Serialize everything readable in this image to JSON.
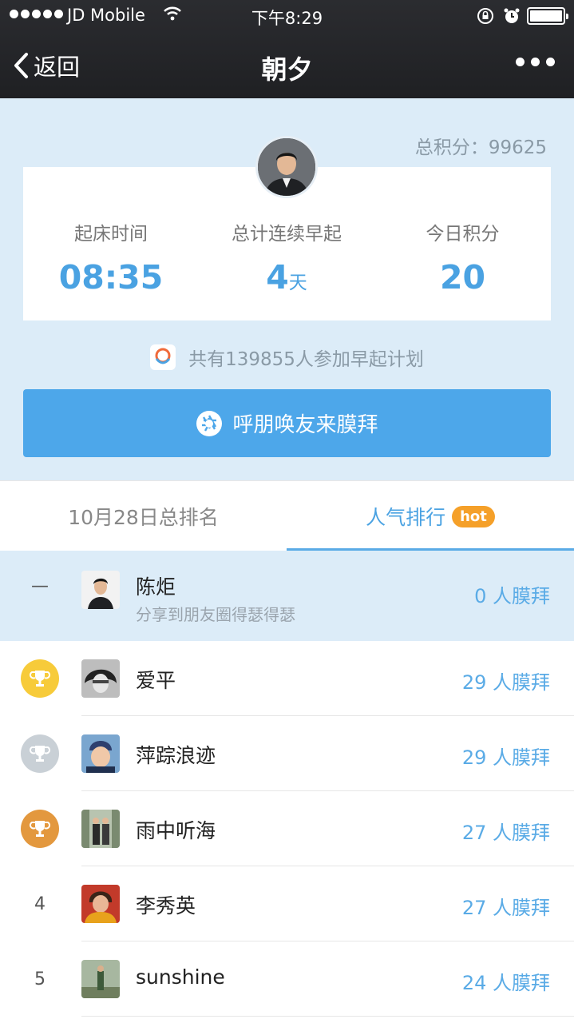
{
  "status_bar": {
    "carrier": "JD Mobile",
    "time": "下午8:29"
  },
  "nav": {
    "back_label": "返回",
    "title": "朝夕"
  },
  "header": {
    "total_points": "总积分：99625",
    "stats": [
      {
        "label": "起床时间",
        "value": "08:35",
        "unit": ""
      },
      {
        "label": "总计连续早起",
        "value": "4",
        "unit": "天"
      },
      {
        "label": "今日积分",
        "value": "20",
        "unit": ""
      }
    ],
    "participants": "共有139855人参加早起计划",
    "cta_label": "呼朋唤友来膜拜"
  },
  "tabs": {
    "total_ranking": "10月28日总排名",
    "popularity": "人气排行",
    "hot_badge": "hot"
  },
  "ranking": [
    {
      "rank": "—",
      "name": "陈炬",
      "subtitle": "分享到朋友圈得瑟得瑟",
      "count": "0 人膜拜"
    },
    {
      "rank": "",
      "medal": "gold",
      "name": "爱平",
      "count": "29 人膜拜"
    },
    {
      "rank": "",
      "medal": "silver",
      "name": "萍踪浪迹",
      "count": "29 人膜拜"
    },
    {
      "rank": "",
      "medal": "bronze",
      "name": "雨中听海",
      "count": "27 人膜拜"
    },
    {
      "rank": "4",
      "name": "李秀英",
      "count": "27 人膜拜"
    },
    {
      "rank": "5",
      "name": "sunshine",
      "count": "24 人膜拜"
    }
  ],
  "colors": {
    "accent": "#4aa2e2",
    "hero_bg": "#dcecf8",
    "gold": "#f7cb3a",
    "silver": "#c9d0d6",
    "bronze": "#e3983e",
    "hot": "#f5a029"
  }
}
